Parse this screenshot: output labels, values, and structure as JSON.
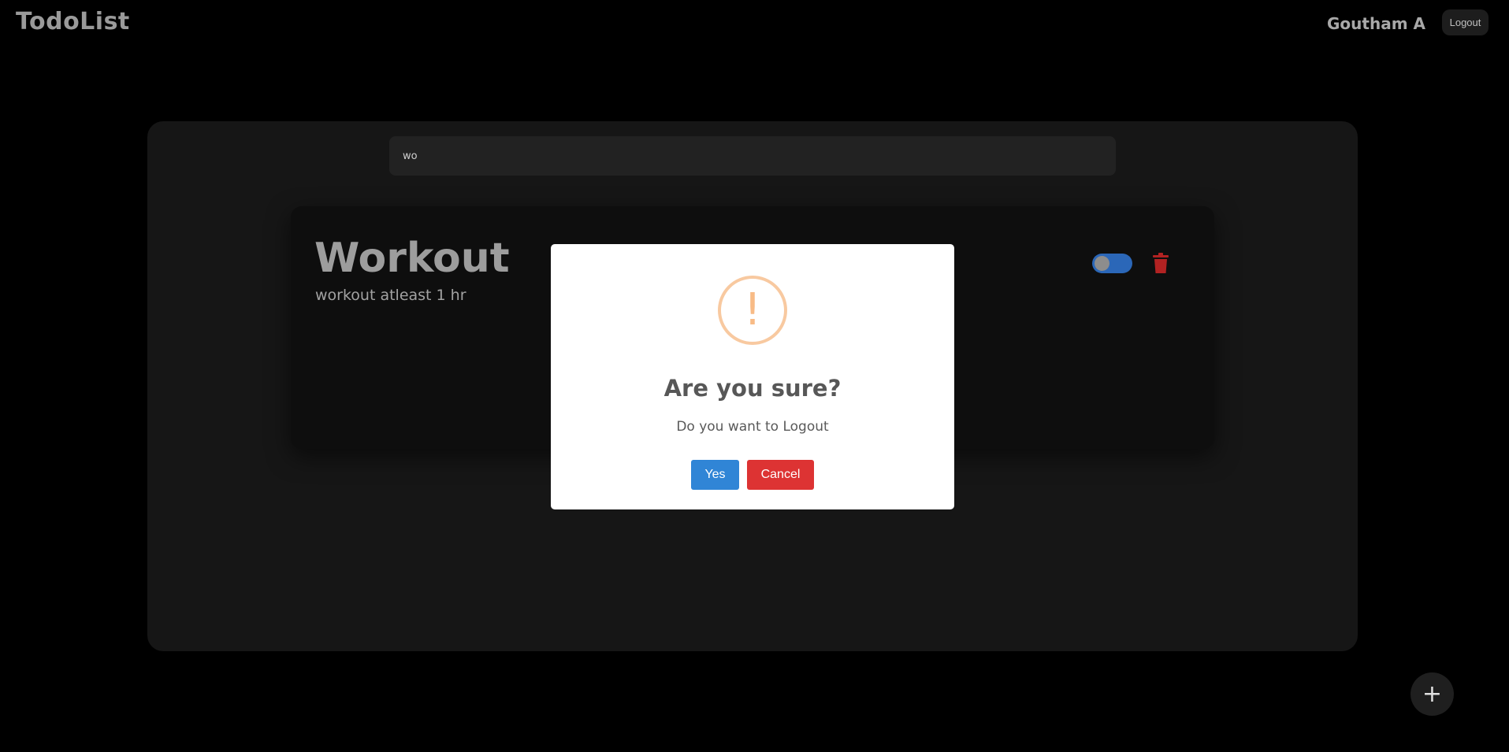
{
  "app": {
    "brand": "TodoList",
    "user_name": "Goutham A",
    "logout_label": "Logout"
  },
  "search": {
    "value": "wo"
  },
  "todos": [
    {
      "title": "Workout",
      "description": "workout atleast 1 hr",
      "completed": false
    }
  ],
  "dialog": {
    "icon": "!",
    "title": "Are you sure?",
    "text": "Do you want to Logout",
    "confirm_label": "Yes",
    "cancel_label": "Cancel"
  },
  "fab": {
    "label": "+"
  },
  "colors": {
    "background": "#000000",
    "board": "#161616",
    "toggle": "#2b67b8",
    "delete": "#b22222",
    "confirm": "#3085d6",
    "cancel": "#dd3333",
    "warning": "#f8bb86"
  }
}
